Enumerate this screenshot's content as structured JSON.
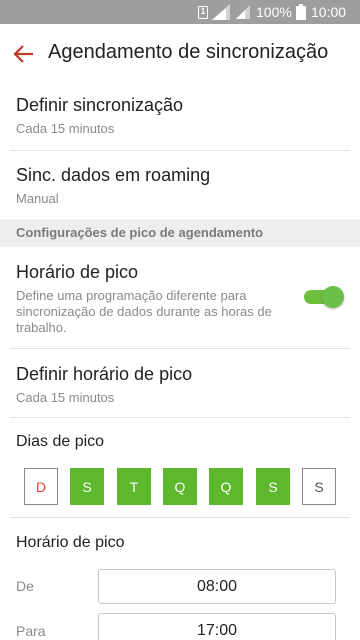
{
  "status_bar": {
    "sim_label": "1",
    "battery": "100%",
    "time": "10:00"
  },
  "app_bar": {
    "title": "Agendamento de sincronização",
    "back_icon": "arrow-left-icon"
  },
  "settings": {
    "sync": {
      "title": "Definir sincronização",
      "value": "Cada 15 minutos"
    },
    "roaming": {
      "title": "Sinc. dados em roaming",
      "value": "Manual"
    }
  },
  "peak_section": {
    "header": "Configurações de pico de agendamento",
    "peak_toggle": {
      "title": "Horário de pico",
      "description": "Define uma programação diferente para sincronização de dados durante as horas de trabalho.",
      "enabled": true
    },
    "peak_sync": {
      "title": "Definir horário de pico",
      "value": "Cada 15 minutos"
    },
    "days_title": "Dias de pico",
    "days": [
      {
        "label": "D",
        "selected": false
      },
      {
        "label": "S",
        "selected": true
      },
      {
        "label": "T",
        "selected": true
      },
      {
        "label": "Q",
        "selected": true
      },
      {
        "label": "Q",
        "selected": true
      },
      {
        "label": "S",
        "selected": true
      },
      {
        "label": "S",
        "selected": false
      }
    ],
    "hours_title": "Horário de pico",
    "from_label": "De",
    "from_value": "08:00",
    "to_label": "Para",
    "to_value": "17:00"
  },
  "colors": {
    "accent_green": "#5db82e",
    "back_arrow": "#c0392b",
    "sunday_red": "#e0453a"
  }
}
